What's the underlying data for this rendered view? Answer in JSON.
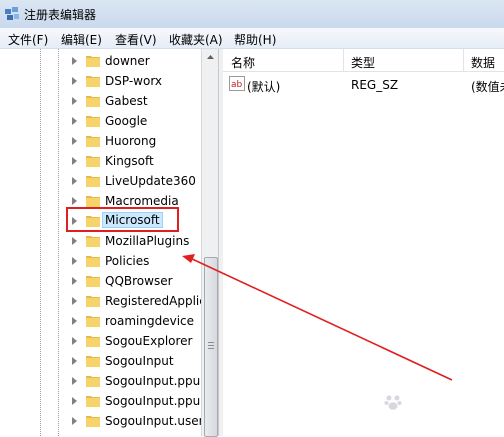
{
  "window": {
    "title": "注册表编辑器"
  },
  "menu": [
    {
      "label": "文件(F)"
    },
    {
      "label": "编辑(E)"
    },
    {
      "label": "查看(V)"
    },
    {
      "label": "收藏夹(A)"
    },
    {
      "label": "帮助(H)"
    }
  ],
  "tree": {
    "items": [
      {
        "label": "downer"
      },
      {
        "label": "DSP-worx"
      },
      {
        "label": "Gabest"
      },
      {
        "label": "Google"
      },
      {
        "label": "Huorong"
      },
      {
        "label": "Kingsoft"
      },
      {
        "label": "LiveUpdate360"
      },
      {
        "label": "Macromedia"
      },
      {
        "label": "Microsoft",
        "selected": true
      },
      {
        "label": "MozillaPlugins"
      },
      {
        "label": "Policies"
      },
      {
        "label": "QQBrowser"
      },
      {
        "label": "RegisteredApplic"
      },
      {
        "label": "roamingdevice"
      },
      {
        "label": "SogouExplorer"
      },
      {
        "label": "SogouInput"
      },
      {
        "label": "SogouInput.ppu"
      },
      {
        "label": "SogouInput.ppu"
      },
      {
        "label": "SogouInput.user"
      }
    ]
  },
  "values_pane": {
    "columns": [
      {
        "label": "名称"
      },
      {
        "label": "类型"
      },
      {
        "label": "数据"
      }
    ],
    "rows": [
      {
        "name": "(默认)",
        "type": "REG_SZ",
        "data": "(数值未"
      }
    ]
  },
  "annotation": {
    "color": "#e02020"
  },
  "icons": {
    "app": "registry-editor-icon",
    "folder": "folder-icon",
    "expand": "expand-triangle-icon",
    "value": "string-value-ab-icon"
  }
}
